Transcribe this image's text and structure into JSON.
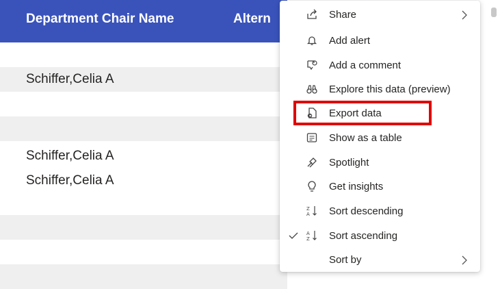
{
  "table": {
    "columns": [
      "Department Chair Name",
      "Altern"
    ],
    "rows": [
      {
        "chair": "",
        "shaded": false
      },
      {
        "chair": "Schiffer,Celia A",
        "shaded": true
      },
      {
        "chair": "",
        "shaded": false
      },
      {
        "chair": "",
        "shaded": true
      },
      {
        "chair": "Schiffer,Celia A",
        "shaded": false
      },
      {
        "chair": "Schiffer,Celia A",
        "shaded": false
      },
      {
        "chair": "",
        "shaded": false
      },
      {
        "chair": "",
        "shaded": true
      },
      {
        "chair": "",
        "shaded": false
      },
      {
        "chair": "",
        "shaded": true
      }
    ]
  },
  "menu": {
    "items": [
      {
        "label": "Share",
        "icon": "share-icon",
        "submenu": true,
        "checked": false
      },
      {
        "label": "Add alert",
        "icon": "bell-icon",
        "submenu": false,
        "checked": false
      },
      {
        "label": "Add a comment",
        "icon": "comment-icon",
        "submenu": false,
        "checked": false
      },
      {
        "label": "Explore this data (preview)",
        "icon": "binoculars-icon",
        "submenu": false,
        "checked": false
      },
      {
        "label": "Export data",
        "icon": "export-icon",
        "submenu": false,
        "checked": false
      },
      {
        "label": "Show as a table",
        "icon": "table-icon",
        "submenu": false,
        "checked": false
      },
      {
        "label": "Spotlight",
        "icon": "spotlight-icon",
        "submenu": false,
        "checked": false
      },
      {
        "label": "Get insights",
        "icon": "lightbulb-icon",
        "submenu": false,
        "checked": false
      },
      {
        "label": "Sort descending",
        "icon": "sort-descending-icon",
        "submenu": false,
        "checked": false
      },
      {
        "label": "Sort ascending",
        "icon": "sort-ascending-icon",
        "submenu": false,
        "checked": true
      },
      {
        "label": "Sort by",
        "icon": "",
        "submenu": true,
        "checked": false
      }
    ],
    "highlighted": "Export data"
  },
  "colors": {
    "header_bg": "#3a53bb",
    "row_shade": "#efefef",
    "highlight": "#e00000"
  }
}
